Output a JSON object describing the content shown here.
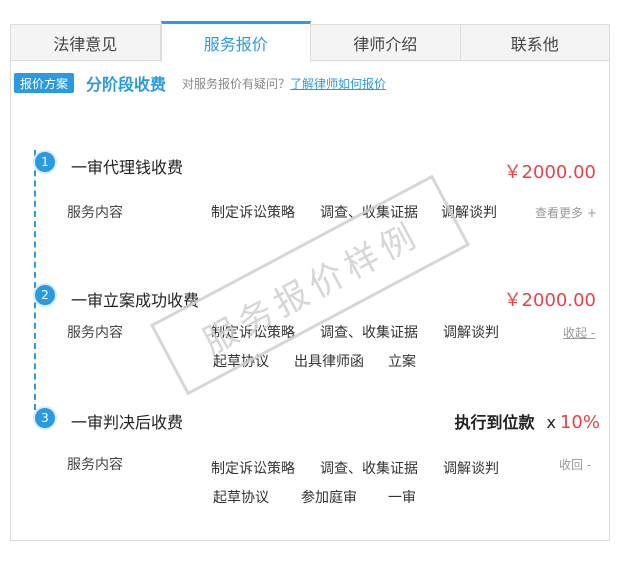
{
  "tabs": [
    {
      "label": "法律意见"
    },
    {
      "label": "服务报价"
    },
    {
      "label": "律师介绍"
    },
    {
      "label": "联系他"
    }
  ],
  "plan": {
    "badge": "报价方案",
    "title": "分阶段收费",
    "question": "对服务报价有疑问？",
    "link": "了解律师如何报价"
  },
  "steps": [
    {
      "number": "1",
      "title": "一审代理钱收费",
      "price": "￥2000.00",
      "service_label": "服务内容",
      "services": [
        "制定诉讼策略",
        "调查、收集证据",
        "调解谈判"
      ],
      "toggle": "查看更多 +"
    },
    {
      "number": "2",
      "title": "一审立案成功收费",
      "price": "￥2000.00",
      "service_label": "服务内容",
      "services": [
        "制定诉讼策略",
        "调查、收集证据",
        "调解谈判",
        "起草协议",
        "出具律师函",
        "立案"
      ],
      "toggle": "收起 -"
    },
    {
      "number": "3",
      "title": "一审判决后收费",
      "exec_label": "执行到位款",
      "exec_x": "x",
      "exec_pct": "10%",
      "service_label": "服务内容",
      "services": [
        "制定诉讼策略",
        "调查、收集证据",
        "调解谈判",
        "起草协议",
        "参加庭审",
        "一审"
      ],
      "toggle": "收回 -"
    }
  ],
  "watermark": "服务报价样例",
  "colors": {
    "accent": "#2c9ae0",
    "price": "#e8434a"
  }
}
